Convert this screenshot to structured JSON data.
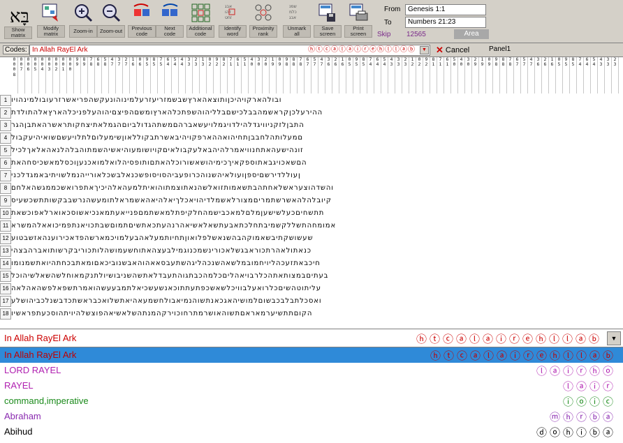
{
  "logo_glyph": "בָּא",
  "toolbar": {
    "buttons": [
      {
        "label": "Show\nmatrix",
        "icon": "matrix-grid-icon"
      },
      {
        "label": "Modify\nmatrix",
        "icon": "modify-matrix-icon"
      },
      {
        "label": "Zoom-in",
        "icon": "zoom-in-icon"
      },
      {
        "label": "Zoom-out",
        "icon": "zoom-out-icon"
      },
      {
        "label": "Previous\ncode",
        "icon": "previous-code-icon"
      },
      {
        "label": "Next\ncode",
        "icon": "next-code-icon"
      },
      {
        "label": "Additional\ncode",
        "icon": "additional-code-icon"
      },
      {
        "label": "Identify\nword",
        "icon": "identify-word-icon"
      },
      {
        "label": "Proximity\nrank",
        "icon": "proximity-rank-icon"
      },
      {
        "label": "Unmark\nall",
        "icon": "unmark-all-icon"
      },
      {
        "label": "Save\nscreen",
        "icon": "save-screen-icon"
      },
      {
        "label": "Print\nscreen",
        "icon": "print-screen-icon"
      }
    ]
  },
  "range": {
    "from_label": "From",
    "from_value": "Genesis 1:1",
    "to_label": "To",
    "to_value": "Numbers 21:23",
    "skip_label": "Skip",
    "skip_value": "12565",
    "area_label": "Area"
  },
  "codes": {
    "label": "Codes:",
    "value": "In Allah RayEl Ark",
    "hebrew": "ⓗⓣⓒⓐⓛⓐⓘⓡⓔⓗⓛⓛⓐⓑ",
    "cancel_label": "Cancel",
    "panel_label": "Panel1"
  },
  "grid": {
    "column_headers": [
      "0\n0\n0\n8",
      "0\n0\n7",
      "0\n0\n6",
      "0\n0\n5",
      "0\n0\n4",
      "0\n0\n3",
      "0\n0\n2",
      "0\n0\n1",
      "0\n0\n0",
      "9\n9",
      "8\n9",
      "7\n8",
      "6\n8",
      "5\n8",
      "4\n7",
      "3\n7",
      "2\n7",
      "1\n6",
      "0\n6",
      "9\n5",
      "8\n5",
      "7\n5",
      "6\n4",
      "5\n4",
      "4\n4",
      "3\n3",
      "2\n3",
      "1\n3",
      "0\n2",
      "9\n2",
      "8\n2",
      "7\n1",
      "6\n1",
      "5\n1",
      "4\n0",
      "3\n0",
      "2\n0",
      "1\n9",
      "0\n9",
      "9\n8",
      "8\n8",
      "7\n8",
      "6\n7",
      "5\n7",
      "4\n7",
      "3\n6",
      "2\n6",
      "1\n6",
      "0\n5",
      "9\n5",
      "8\n5",
      "7\n4",
      "6\n4",
      "5\n4",
      "4\n3",
      "3\n3",
      "2\n3",
      "1\n2",
      "0\n2",
      "9\n2",
      "8\n1",
      "7\n1",
      "6\n1",
      "5\n0",
      "4\n0",
      "3\n0",
      "2\n9",
      "1\n9",
      "0\n9",
      "9\n8",
      "8\n8",
      "7\n8",
      "6\n7",
      "5\n7",
      "4\n7",
      "3\n6",
      "2\n6",
      "1\n6",
      "0\n5",
      "9\n5",
      "8\n5",
      "7\n4",
      "6\n4",
      "5\n4",
      "4\n3",
      "3\n3",
      "2\n3"
    ],
    "rows": [
      {
        "num": "1",
        "text": "ובולהארקויהיכןותוצאהארץשבשמזריעזרעלמינוהונעקשהפריאשרזרעובולמינהויו"
      },
      {
        "num": "2",
        "text": "ההירעלכןקראשמהבבלכישםבלליהוהשפתכלהארץומשםהפיצםיהוהעלפניכלהארץאלהתולדת"
      },
      {
        "num": "3",
        "text": "התבןלזקניוויגדלהילדויגמלויעשאברהםמשתהגדולביוםהגמלאתיצחקותראשרהאתבןהגר"
      },
      {
        "num": "4",
        "text": "םמעלותהלחבבןתחיהואההארפקויהיבאשרתבקוללאוןשימעלוםלתלויעשםשואיהיעקבול"
      },
      {
        "num": "5",
        "text": "זונהישעהאתחנוויאמרלהיהבאלעקבולאיםקויושומעוהיאשיהשמתוהבלהלנאהאלאךלכיל"
      },
      {
        "num": "6",
        "text": "הםשאכויגבאתוספקאיךכימיהושאשורוכלהאתםותופסיהלואלמואכנעןוכסלמאשכיסחהאת"
      },
      {
        "num": "7",
        "text": "ןעוללדירשםיספןועולאיהשנוהכרופעביהסויסופשכנאלבשכלאורייהנמלשויתיבאמגדלכני"
      },
      {
        "num": "8",
        "text": "והשדהוצעראשלאחתהבתשאמותזואלשהנאתוצמתוהואיתלמעהאלהיכיךאתפרואשכממגשהאלחם"
      },
      {
        "num": "9",
        "text": "קיובלהלהאשרשתמריםמצורלאשמלדיהויאכלךיאלהיאהאשמראלתומעשהנרשבבקשותתשכשעיס"
      },
      {
        "num": "10",
        "text": "תתשחיםכעלשישעןמלםלמאכבישמהחלקיפתלמאשתמםפנייאעתמאנכיאשוסכאוארלאפוכשאת"
      },
      {
        "num": "11",
        "text": "אמומחהתשללקשמיבתחלכתאבעתשאלאשיאהרנהעתכאתשיםתמוםשבתכויאנתפמיכואאלהמשרא"
      },
      {
        "num": "12",
        "text": "שעשושקתיבשאמוקהבהשנאשלפלואוןתחיותמעלאהבעלמויכמארשהפדאכירוענהאזשבטוע"
      },
      {
        "num": "13",
        "text": "כנאתולאהרתכוראבגשלאכורינשמכנוגמילבעצהאתוחשעמושהלותכוריבקרשותואברהבצהי"
      },
      {
        "num": "14",
        "text": "חיכבאתזעכהליויחמובמלשאהשנכהליגהשתעבסאאהוהאבשנוביכאםומאתבכחתהיואתשמנומו"
      },
      {
        "num": "15",
        "text": "בעתיםבמצותאתהכלרבויאהליםכלמהכבתגוהתעבדלאתשהשניבושיולתנקמאוחלשהשאלשיהוכל"
      },
      {
        "num": "16",
        "text": "עליתוטהשיםכלרואעלבוויכלשאשכפתעתתוכאנשעשכיאלתמבעעשהואמרתשפאלפשהאהלאה"
      },
      {
        "num": "17",
        "text": "ואסכלתבלבכבשוםלמושיהאגכאנתשוהנמיאבולחשמעאהיאתשלואכבראשתכדבשנלכביהושלע"
      },
      {
        "num": "18",
        "text": "הקוםתתשיערמאראםתשוהאושרמתרחוכוירקהמנתהשלאשיאהפוצשלהיויתהוסכעתפראשיו"
      }
    ]
  },
  "bottom_combo": {
    "value": "In Allah RayEl Ark",
    "hebrew": "ⓗⓣⓒⓐⓛⓐⓘⓡⓔⓗⓛⓛⓐⓑ"
  },
  "code_list": [
    {
      "text": "In Allah RayEl Ark",
      "hebrew": "ⓗⓣⓒⓐⓛⓐⓘⓡⓔⓗⓛⓛⓐⓑ",
      "color": "#c00000",
      "selected": true
    },
    {
      "text": "LORD RAYEL",
      "hebrew": "ⓛⓐⓘⓡⓗⓞ",
      "color": "#b020b0",
      "selected": false
    },
    {
      "text": "RAYEL",
      "hebrew": "ⓛⓐⓘⓡ",
      "color": "#b020b0",
      "selected": false
    },
    {
      "text": "command,imperative",
      "hebrew": "ⓘⓞⓘⓒ",
      "color": "#1a8a1a",
      "selected": false
    },
    {
      "text": "Abraham",
      "hebrew": "ⓜⓗⓡⓑⓐ",
      "color": "#8a2ab0",
      "selected": false
    },
    {
      "text": "Abihud",
      "hebrew": "ⓓⓞⓗⓘⓑⓐ",
      "color": "#000000",
      "selected": false
    }
  ]
}
